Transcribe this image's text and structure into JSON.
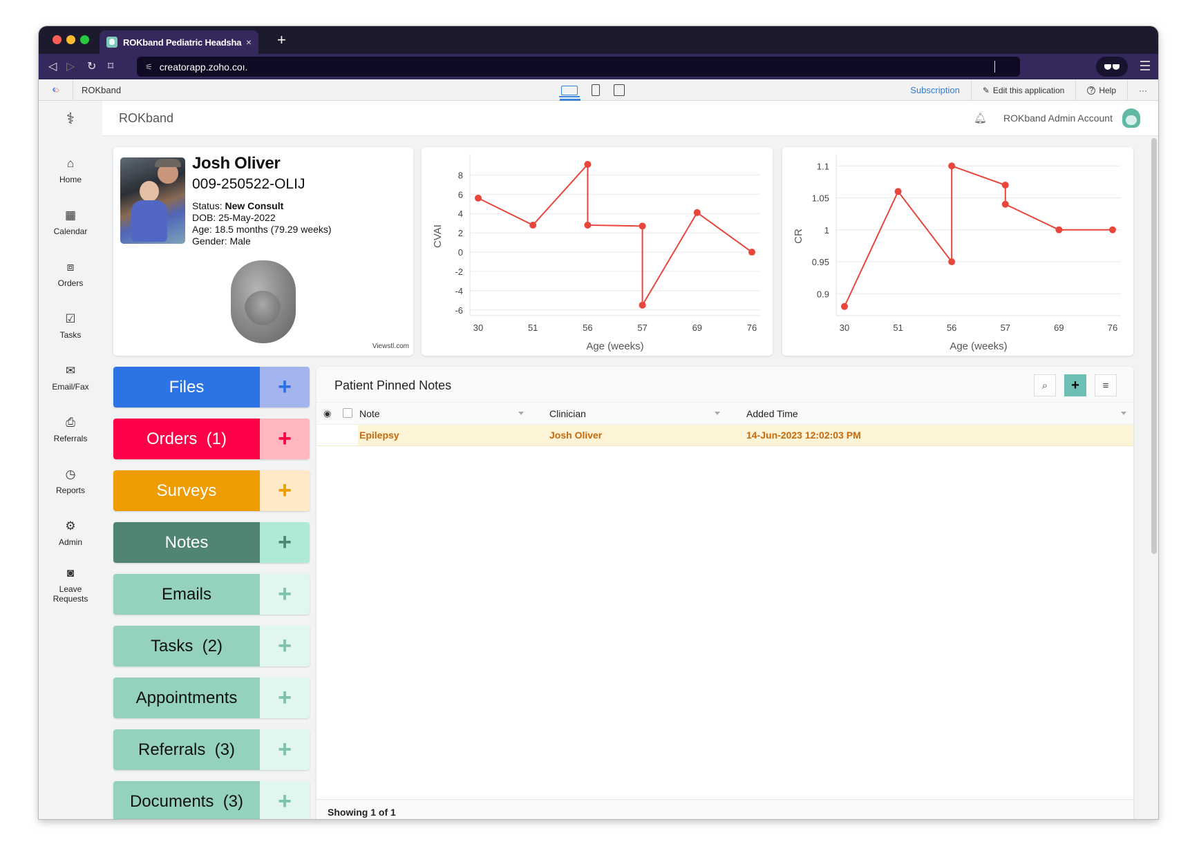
{
  "browser": {
    "tab_title": "ROKband Pediatric Headshape",
    "tab_close": "×",
    "new_tab": "+",
    "url": "creatorapp.zoho.coı.",
    "nav": {
      "back": "◁",
      "forward": "▷",
      "reload": "↻",
      "bookmark": "⌑"
    }
  },
  "zoho_bar": {
    "app_name": "ROKband",
    "subscription": "Subscription",
    "edit_app": "Edit this application",
    "help": "Help",
    "more": "···"
  },
  "app_header": {
    "title": "ROKband",
    "user": "ROKband Admin Account"
  },
  "sidebar": {
    "items": [
      {
        "label": "Home",
        "icon": "⌂"
      },
      {
        "label": "Calendar",
        "icon": "▦"
      },
      {
        "label": "Orders",
        "icon": "⧈"
      },
      {
        "label": "Tasks",
        "icon": "☑"
      },
      {
        "label": "Email/Fax",
        "icon": "✉"
      },
      {
        "label": "Referrals",
        "icon": "⎙"
      },
      {
        "label": "Reports",
        "icon": "◷"
      },
      {
        "label": "Admin",
        "icon": "⚙"
      },
      {
        "label": "Leave Requests",
        "icon": "◙"
      }
    ]
  },
  "patient": {
    "name": "Josh Oliver",
    "id": "009-250522-OLIJ",
    "status_label": "Status: ",
    "status": "New Consult",
    "dob": "DOB: 25-May-2022",
    "age": "Age: 18.5 months (79.29 weeks)",
    "gender": "Gender: Male",
    "viewer_credit": "Viewstl.com"
  },
  "actions": [
    {
      "label": "Files",
      "main_color": "#2c74e6",
      "add_color": "#a4b4ee",
      "text_color": "#ffffff",
      "plus_color": "#2c74e6"
    },
    {
      "label": "Orders  (1)",
      "main_color": "#ff0048",
      "add_color": "#ffb6bf",
      "text_color": "#ffffff",
      "plus_color": "#ff0048"
    },
    {
      "label": "Surveys",
      "main_color": "#ee9c00",
      "add_color": "#ffe9c6",
      "text_color": "#ffffff",
      "plus_color": "#ee9c00"
    },
    {
      "label": "Notes",
      "main_color": "#508571",
      "add_color": "#aeead6",
      "text_color": "#ffffff",
      "plus_color": "#508571"
    },
    {
      "label": "Emails",
      "main_color": "#94d2bd",
      "add_color": "#e1f6ef",
      "text_color": "#111111",
      "plus_color": "#7cc3a8"
    },
    {
      "label": "Tasks  (2)",
      "main_color": "#94d2bd",
      "add_color": "#e1f6ef",
      "text_color": "#111111",
      "plus_color": "#7cc3a8"
    },
    {
      "label": "Appointments",
      "main_color": "#94d2bd",
      "add_color": "#e1f6ef",
      "text_color": "#111111",
      "plus_color": "#7cc3a8"
    },
    {
      "label": "Referrals  (3)",
      "main_color": "#94d2bd",
      "add_color": "#e1f6ef",
      "text_color": "#111111",
      "plus_color": "#7cc3a8"
    },
    {
      "label": "Documents  (3)",
      "main_color": "#94d2bd",
      "add_color": "#e1f6ef",
      "text_color": "#111111",
      "plus_color": "#7cc3a8"
    }
  ],
  "notes_panel": {
    "title": "Patient Pinned Notes",
    "columns": [
      "Note",
      "Clinician",
      "Added Time"
    ],
    "rows": [
      {
        "note": "Epilepsy",
        "clinician": "Josh Oliver",
        "added_time": "14-Jun-2023 12:02:03 PM"
      }
    ],
    "footer": "Showing 1 of 1"
  },
  "chart_data": [
    {
      "type": "line",
      "title": "",
      "xlabel": "Age (weeks)",
      "ylabel": "CVAI",
      "categories": [
        "30",
        "51",
        "56",
        "57",
        "69",
        "76"
      ],
      "points": [
        {
          "x": "30",
          "y": 5.6
        },
        {
          "x": "51",
          "y": 2.8
        },
        {
          "x": "56",
          "y": 9.1
        },
        {
          "x": "56",
          "y": 2.8
        },
        {
          "x": "57",
          "y": 2.7
        },
        {
          "x": "57",
          "y": -5.5
        },
        {
          "x": "69",
          "y": 4.1
        },
        {
          "x": "76",
          "y": 0.0
        }
      ],
      "yticks": [
        8,
        6,
        4,
        2,
        0,
        -2,
        -4,
        -6
      ],
      "ylim": [
        -6.3,
        9.6
      ],
      "grid": true,
      "color": "#e8463a"
    },
    {
      "type": "line",
      "title": "",
      "xlabel": "Age (weeks)",
      "ylabel": "CR",
      "categories": [
        "30",
        "51",
        "56",
        "57",
        "69",
        "76"
      ],
      "points": [
        {
          "x": "30",
          "y": 0.88
        },
        {
          "x": "51",
          "y": 1.06
        },
        {
          "x": "56",
          "y": 0.95
        },
        {
          "x": "56",
          "y": 1.1
        },
        {
          "x": "57",
          "y": 1.07
        },
        {
          "x": "57",
          "y": 1.04
        },
        {
          "x": "69",
          "y": 1.0
        },
        {
          "x": "76",
          "y": 1.0
        }
      ],
      "yticks": [
        1.1,
        1.05,
        1,
        0.95,
        0.9
      ],
      "ytick_labels": [
        "1.1",
        "1.05",
        "1",
        "0.95",
        "0.9"
      ],
      "ylim": [
        0.87,
        1.11
      ],
      "grid": true,
      "color": "#e8463a"
    }
  ]
}
